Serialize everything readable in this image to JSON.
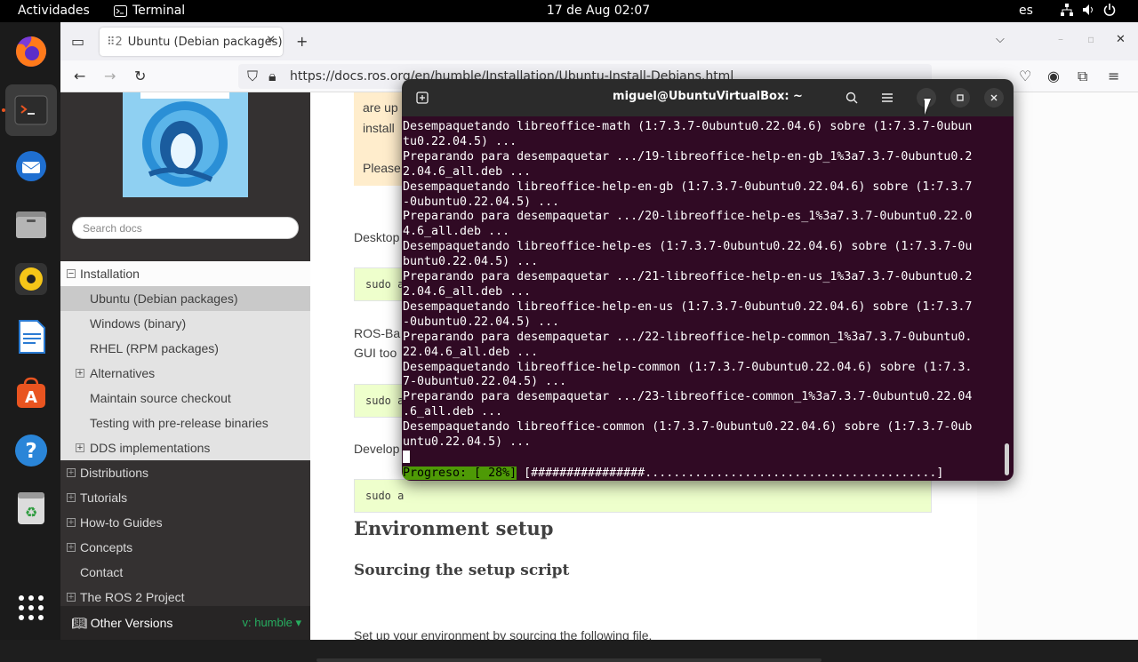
{
  "topbar": {
    "activities": "Actividades",
    "app_name": "Terminal",
    "clock": "17 de Aug  02:07",
    "language": "es"
  },
  "dock": {
    "items": [
      "firefox-icon",
      "terminal-icon",
      "thunderbird-icon",
      "files-icon",
      "rhythmbox-icon",
      "writer-icon",
      "app-center-icon",
      "help-icon",
      "trash-icon",
      "show-apps-icon"
    ]
  },
  "browser": {
    "tab_title": "Ubuntu (Debian packages)",
    "tab_prefix": "⠿2",
    "url": "https://docs.ros.org/en/humble/Installation/Ubuntu-Install-Debians.html"
  },
  "sidebar": {
    "search_placeholder": "Search docs",
    "menu": [
      {
        "label": "Installation",
        "level": "top",
        "expanded": true
      },
      {
        "label": "Ubuntu (Debian packages)",
        "level": "sub",
        "selected": true
      },
      {
        "label": "Windows (binary)",
        "level": "sub"
      },
      {
        "label": "RHEL (RPM packages)",
        "level": "sub"
      },
      {
        "label": "Alternatives",
        "level": "sub",
        "expandable": true
      },
      {
        "label": "Maintain source checkout",
        "level": "sub"
      },
      {
        "label": "Testing with pre-release binaries",
        "level": "sub"
      },
      {
        "label": "DDS implementations",
        "level": "sub",
        "expandable": true
      },
      {
        "label": "Distributions",
        "level": "l1",
        "expandable": true
      },
      {
        "label": "Tutorials",
        "level": "l1",
        "expandable": true
      },
      {
        "label": "How-to Guides",
        "level": "l1",
        "expandable": true
      },
      {
        "label": "Concepts",
        "level": "l1",
        "expandable": true
      },
      {
        "label": "Contact",
        "level": "l1"
      },
      {
        "label": "The ROS 2 Project",
        "level": "l1",
        "expandable": true
      }
    ],
    "other_versions": "Other Versions",
    "version": "v: humble"
  },
  "content": {
    "note_line1": "are up",
    "note_line2": "install",
    "note_line3": "Please",
    "p1": "Desktop",
    "code1": "sudo a",
    "p2a": "ROS-Ba",
    "p2b": "GUI too",
    "code2": "sudo a",
    "p3": "Develop",
    "code3": "sudo a",
    "h2": "Environment setup",
    "h3": "Sourcing the setup script",
    "p4": "Set up your environment by sourcing the following file."
  },
  "terminal": {
    "title": "miguel@UbuntuVirtualBox: ~",
    "lines": [
      "Desempaquetando libreoffice-math (1:7.3.7-0ubuntu0.22.04.6) sobre (1:7.3.7-0ubun",
      "tu0.22.04.5) ...",
      "Preparando para desempaquetar .../19-libreoffice-help-en-gb_1%3a7.3.7-0ubuntu0.2",
      "2.04.6_all.deb ...",
      "Desempaquetando libreoffice-help-en-gb (1:7.3.7-0ubuntu0.22.04.6) sobre (1:7.3.7",
      "-0ubuntu0.22.04.5) ...",
      "Preparando para desempaquetar .../20-libreoffice-help-es_1%3a7.3.7-0ubuntu0.22.0",
      "4.6_all.deb ...",
      "Desempaquetando libreoffice-help-es (1:7.3.7-0ubuntu0.22.04.6) sobre (1:7.3.7-0u",
      "buntu0.22.04.5) ...",
      "Preparando para desempaquetar .../21-libreoffice-help-en-us_1%3a7.3.7-0ubuntu0.2",
      "2.04.6_all.deb ...",
      "Desempaquetando libreoffice-help-en-us (1:7.3.7-0ubuntu0.22.04.6) sobre (1:7.3.7",
      "-0ubuntu0.22.04.5) ...",
      "Preparando para desempaquetar .../22-libreoffice-help-common_1%3a7.3.7-0ubuntu0.",
      "22.04.6_all.deb ...",
      "Desempaquetando libreoffice-help-common (1:7.3.7-0ubuntu0.22.04.6) sobre (1:7.3.",
      "7-0ubuntu0.22.04.5) ...",
      "Preparando para desempaquetar .../23-libreoffice-common_1%3a7.3.7-0ubuntu0.22.04",
      ".6_all.deb ...",
      "Desempaquetando libreoffice-common (1:7.3.7-0ubuntu0.22.04.6) sobre (1:7.3.7-0ub",
      "untu0.22.04.5) ..."
    ],
    "progress_label": "Progreso: [ 28%]",
    "progress_bar": " [################.........................................] ",
    "progress_percent": 28
  }
}
